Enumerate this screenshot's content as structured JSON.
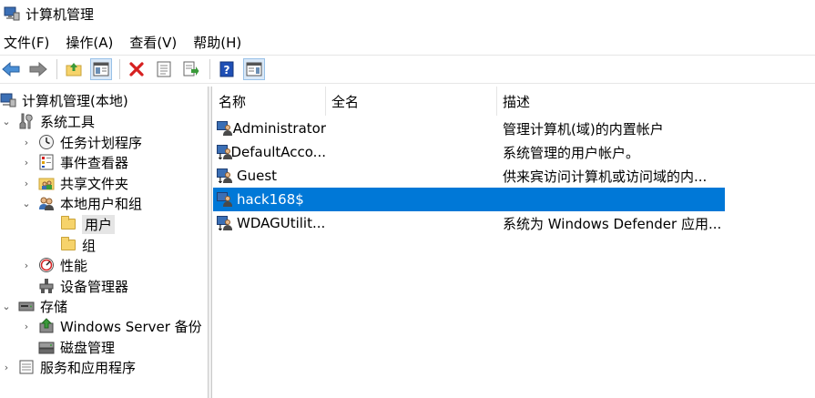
{
  "window": {
    "title": "计算机管理"
  },
  "menu": {
    "items": [
      "文件(F)",
      "操作(A)",
      "查看(V)",
      "帮助(H)"
    ]
  },
  "toolbar": {
    "icons": [
      "back-arrow-icon",
      "forward-arrow-icon",
      "up-folder-icon",
      "show-hide-tree-icon",
      "delete-icon",
      "properties-icon",
      "export-list-icon",
      "help-icon",
      "show-hide-action-pane-icon"
    ]
  },
  "tree": {
    "root": "计算机管理(本地)",
    "system_tools": "系统工具",
    "task_scheduler": "任务计划程序",
    "event_viewer": "事件查看器",
    "shared_folders": "共享文件夹",
    "local_users_groups": "本地用户和组",
    "users": "用户",
    "groups": "组",
    "performance": "性能",
    "device_manager": "设备管理器",
    "storage": "存储",
    "windows_server_backup": "Windows Server 备份",
    "disk_management": "磁盘管理",
    "services_apps": "服务和应用程序"
  },
  "list": {
    "columns": {
      "name": "名称",
      "fullname": "全名",
      "description": "描述"
    },
    "rows": [
      {
        "name": "Administrator",
        "fullname": "",
        "description": "管理计算机(域)的内置帐户"
      },
      {
        "name": "DefaultAcco...",
        "fullname": "",
        "description": "系统管理的用户帐户。"
      },
      {
        "name": "Guest",
        "fullname": "",
        "description": "供来宾访问计算机或访问域的内..."
      },
      {
        "name": "hack168$",
        "fullname": "",
        "description": ""
      },
      {
        "name": "WDAGUtilit...",
        "fullname": "",
        "description": "系统为 Windows Defender 应用..."
      }
    ],
    "selected_index": 3
  },
  "colors": {
    "selection": "#0078d7",
    "tree_selection": "#e5e5e5"
  }
}
